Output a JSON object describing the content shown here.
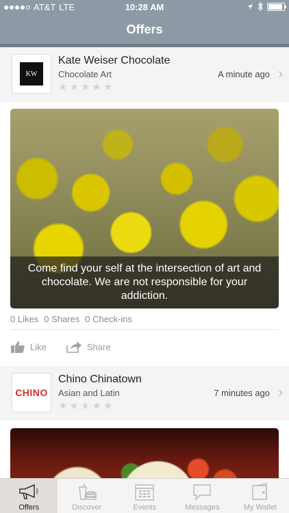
{
  "status_bar": {
    "carrier": "AT&T",
    "network": "LTE",
    "time": "10:28 AM",
    "battery_level": 0.9,
    "icons": [
      "signal-dots-icon",
      "location-arrow-icon",
      "bluetooth-icon",
      "battery-icon"
    ]
  },
  "nav": {
    "title": "Offers"
  },
  "offers": [
    {
      "merchant_name": "Kate Weiser Chocolate",
      "category": "Chocolate Art",
      "time": "A minute ago",
      "rating": 0,
      "logo_text": "KW",
      "caption": "Come find your self at the intersection of art and chocolate. We are not responsible for your addiction.",
      "stats": {
        "likes": "0 Likes",
        "shares": "0 Shares",
        "checkins": "0 Check-ins"
      },
      "actions": {
        "like": "Like",
        "share": "Share"
      }
    },
    {
      "merchant_name": "Chino Chinatown",
      "category": "Asian and Latin",
      "time": "7 minutes ago",
      "rating": 0,
      "logo_text": "CHINO"
    }
  ],
  "tabs": [
    {
      "label": "Offers",
      "icon": "megaphone-icon",
      "active": true
    },
    {
      "label": "Discover",
      "icon": "drink-burger-icon",
      "active": false
    },
    {
      "label": "Events",
      "icon": "calendar-icon",
      "active": false
    },
    {
      "label": "Messages",
      "icon": "chat-bubble-icon",
      "active": false
    },
    {
      "label": "My Wallet",
      "icon": "wallet-icon",
      "active": false
    }
  ],
  "colors": {
    "header": "#8d9aa6",
    "accent_logo": "#d52b2b",
    "tab_active_bg": "#e3ddd9"
  }
}
